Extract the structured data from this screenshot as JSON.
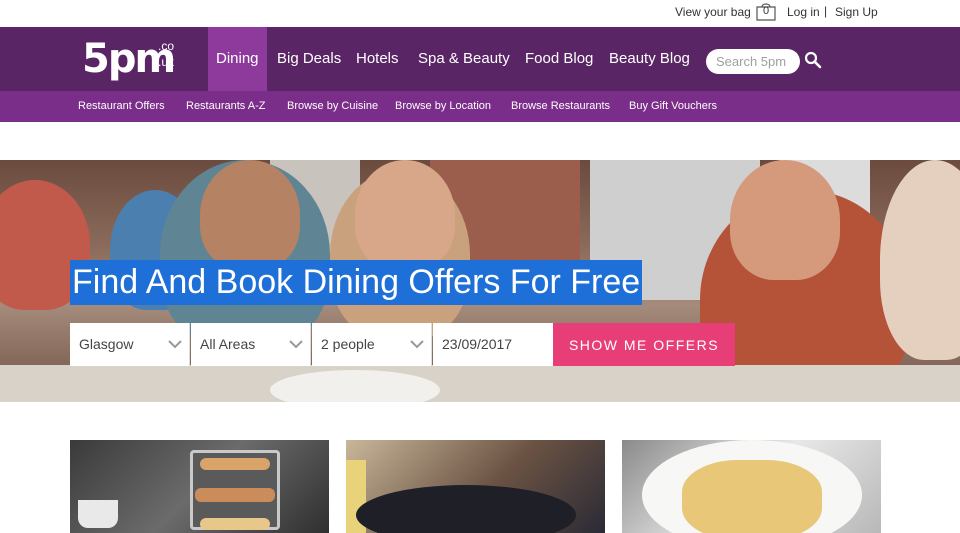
{
  "util": {
    "bag_label": "View your bag",
    "bag_count": "0",
    "login": "Log in",
    "separator": "|",
    "signup": "Sign Up"
  },
  "logo": {
    "main": "5pm",
    "co": ".co",
    "uk": ".uk"
  },
  "nav": {
    "items": [
      "Dining",
      "Big Deals",
      "Hotels",
      "Spa & Beauty",
      "Food Blog",
      "Beauty Blog"
    ],
    "active": "Dining",
    "search_placeholder": "Search 5pm"
  },
  "subnav": {
    "items": [
      "Restaurant Offers",
      "Restaurants A-Z",
      "Browse by Cuisine",
      "Browse by Location",
      "Browse Restaurants",
      "Buy Gift Vouchers"
    ]
  },
  "hero": {
    "headline": "Find And Book Dining Offers For Free",
    "location": "Glasgow",
    "area": "All Areas",
    "people": "2 people",
    "date": "23/09/2017",
    "cta": "SHOW ME OFFERS"
  },
  "colors": {
    "nav_bg": "#5a2565",
    "nav_active": "#8e3a9d",
    "subnav_bg": "#7b2d8a",
    "headline_bg": "#1e6fd8",
    "cta_bg": "#e83e78"
  }
}
